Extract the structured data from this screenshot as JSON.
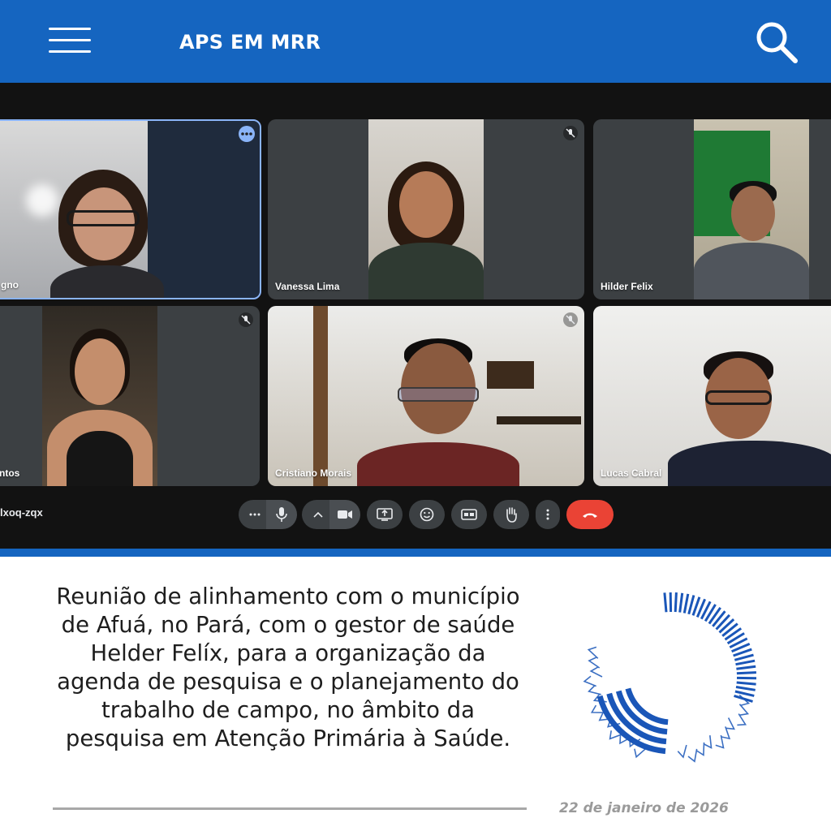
{
  "header": {
    "title": "APS EM MRR",
    "menu_icon": "hamburger-menu-icon",
    "search_icon": "search-icon",
    "background_color": "#1565c0"
  },
  "meeting": {
    "participants": [
      {
        "name": "gno"
      },
      {
        "name": "Vanessa Lima"
      },
      {
        "name": "Hilder Felix"
      },
      {
        "name": "ntos"
      },
      {
        "name": "Cristiano Morais"
      },
      {
        "name": "Lucas Cabral"
      }
    ],
    "meeting_code": "lxoq-zqx",
    "controls": [
      "more-options-icon",
      "microphone-icon",
      "chevron-up-icon",
      "camera-icon",
      "present-screen-icon",
      "emoji-icon",
      "captions-icon",
      "raise-hand-icon",
      "more-vert-icon",
      "end-call-icon"
    ],
    "end_call_color": "#ea4335"
  },
  "caption": {
    "text": "Reunião de alinhamento com o município de Afuá, no Pará, com o gestor de saúde Helder Felíx, para a organização da agenda de pesquisa e o planejamento do trabalho de campo, no âmbito da pesquisa em Atenção Primária à Saúde."
  },
  "footer": {
    "date": "22 de janeiro de 2026"
  }
}
